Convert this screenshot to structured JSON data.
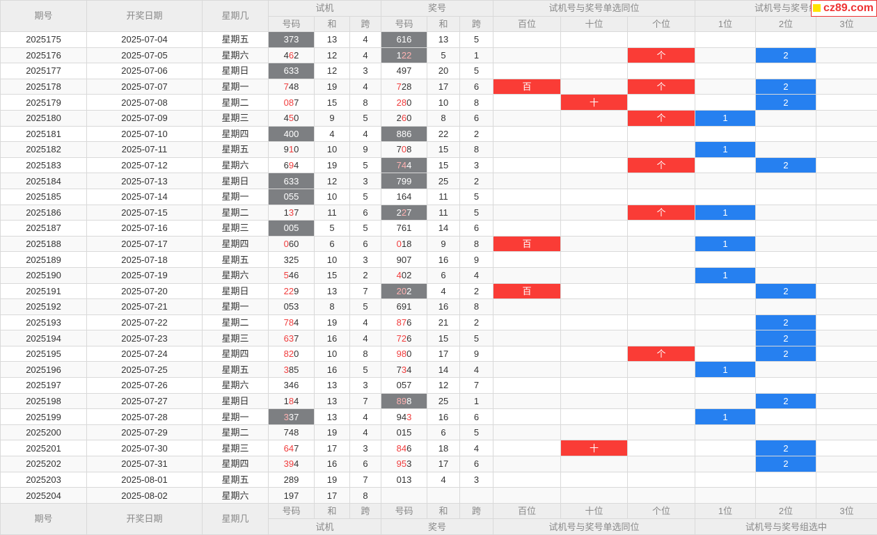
{
  "header": {
    "col_issue": "期号",
    "col_date": "开奖日期",
    "col_weekday": "星期几",
    "group_trial": "试机",
    "group_prize": "奖号",
    "group_single": "试机号与奖号单选同位",
    "group_combo_top": "试机号与奖号组",
    "sub_code": "号码",
    "sub_sum": "和",
    "sub_span": "跨",
    "sub_hundred": "百位",
    "sub_ten": "十位",
    "sub_unit": "个位",
    "sub_c1": "1位",
    "sub_c2": "2位",
    "sub_c3": "3位"
  },
  "footer": {
    "group_combo": "试机号与奖号组选中"
  },
  "watermark": "cz89.com",
  "colors": {
    "gray": "#7d7f82",
    "red": "#fa3c36",
    "blue": "#2680f0",
    "text_red": "#f03c3c"
  },
  "rows": [
    {
      "issue": "2025175",
      "date": "2025-07-04",
      "wd": "星期五",
      "t": "373",
      "th": 0,
      "ts": "13",
      "tk": "4",
      "p": "616",
      "ph": 0,
      "ps": "13",
      "pk": "5",
      "tg": 1,
      "pg": 1,
      "b": "",
      "s": "",
      "g": "",
      "c1": "",
      "c2": "",
      "c3": ""
    },
    {
      "issue": "2025176",
      "date": "2025-07-05",
      "wd": "星期六",
      "t": "462",
      "th": 2,
      "ts": "12",
      "tk": "4",
      "p": "122",
      "ph": 3,
      "ps": "5",
      "pk": "1",
      "tg": 0,
      "pg": 1,
      "b": "",
      "s": "",
      "g": "个",
      "c1": "",
      "c2": "2",
      "c3": ""
    },
    {
      "issue": "2025177",
      "date": "2025-07-06",
      "wd": "星期日",
      "t": "633",
      "th": 0,
      "ts": "12",
      "tk": "3",
      "p": "497",
      "ph": 0,
      "ps": "20",
      "pk": "5",
      "tg": 1,
      "pg": 0,
      "b": "",
      "s": "",
      "g": "",
      "c1": "",
      "c2": "",
      "c3": ""
    },
    {
      "issue": "2025178",
      "date": "2025-07-07",
      "wd": "星期一",
      "t": "748",
      "th": 4,
      "ts": "19",
      "tk": "4",
      "p": "728",
      "ph": 4,
      "ps": "17",
      "pk": "6",
      "tg": 0,
      "pg": 0,
      "b": "百",
      "s": "",
      "g": "个",
      "c1": "",
      "c2": "2",
      "c3": ""
    },
    {
      "issue": "2025179",
      "date": "2025-07-08",
      "wd": "星期二",
      "t": "087",
      "th": 6,
      "ts": "15",
      "tk": "8",
      "p": "280",
      "ph": 6,
      "ps": "10",
      "pk": "8",
      "tg": 0,
      "pg": 0,
      "b": "",
      "s": "十",
      "g": "",
      "c1": "",
      "c2": "2",
      "c3": ""
    },
    {
      "issue": "2025180",
      "date": "2025-07-09",
      "wd": "星期三",
      "t": "450",
      "th": 2,
      "ts": "9",
      "tk": "5",
      "p": "260",
      "ph": 2,
      "ps": "8",
      "pk": "6",
      "tg": 0,
      "pg": 0,
      "b": "",
      "s": "",
      "g": "个",
      "c1": "1",
      "c2": "",
      "c3": ""
    },
    {
      "issue": "2025181",
      "date": "2025-07-10",
      "wd": "星期四",
      "t": "400",
      "th": 0,
      "ts": "4",
      "tk": "4",
      "p": "886",
      "ph": 0,
      "ps": "22",
      "pk": "2",
      "tg": 1,
      "pg": 1,
      "b": "",
      "s": "",
      "g": "",
      "c1": "",
      "c2": "",
      "c3": ""
    },
    {
      "issue": "2025182",
      "date": "2025-07-11",
      "wd": "星期五",
      "t": "910",
      "th": 2,
      "ts": "10",
      "tk": "9",
      "p": "708",
      "ph": 2,
      "ps": "15",
      "pk": "8",
      "tg": 0,
      "pg": 0,
      "b": "",
      "s": "",
      "g": "",
      "c1": "1",
      "c2": "",
      "c3": ""
    },
    {
      "issue": "2025183",
      "date": "2025-07-12",
      "wd": "星期六",
      "t": "694",
      "th": 2,
      "ts": "19",
      "tk": "5",
      "p": "744",
      "ph": 6,
      "ps": "15",
      "pk": "3",
      "tg": 0,
      "pg": 1,
      "b": "",
      "s": "",
      "g": "个",
      "c1": "",
      "c2": "2",
      "c3": ""
    },
    {
      "issue": "2025184",
      "date": "2025-07-13",
      "wd": "星期日",
      "t": "633",
      "th": 0,
      "ts": "12",
      "tk": "3",
      "p": "799",
      "ph": 0,
      "ps": "25",
      "pk": "2",
      "tg": 1,
      "pg": 1,
      "b": "",
      "s": "",
      "g": "",
      "c1": "",
      "c2": "",
      "c3": ""
    },
    {
      "issue": "2025185",
      "date": "2025-07-14",
      "wd": "星期一",
      "t": "055",
      "th": 0,
      "ts": "10",
      "tk": "5",
      "p": "164",
      "ph": 0,
      "ps": "11",
      "pk": "5",
      "tg": 1,
      "pg": 0,
      "b": "",
      "s": "",
      "g": "",
      "c1": "",
      "c2": "",
      "c3": ""
    },
    {
      "issue": "2025186",
      "date": "2025-07-15",
      "wd": "星期二",
      "t": "137",
      "th": 2,
      "ts": "11",
      "tk": "6",
      "p": "227",
      "ph": 2,
      "ps": "11",
      "pk": "5",
      "tg": 0,
      "pg": 1,
      "b": "",
      "s": "",
      "g": "个",
      "c1": "1",
      "c2": "",
      "c3": ""
    },
    {
      "issue": "2025187",
      "date": "2025-07-16",
      "wd": "星期三",
      "t": "005",
      "th": 0,
      "ts": "5",
      "tk": "5",
      "p": "761",
      "ph": 0,
      "ps": "14",
      "pk": "6",
      "tg": 1,
      "pg": 0,
      "b": "",
      "s": "",
      "g": "",
      "c1": "",
      "c2": "",
      "c3": ""
    },
    {
      "issue": "2025188",
      "date": "2025-07-17",
      "wd": "星期四",
      "t": "060",
      "th": 4,
      "ts": "6",
      "tk": "6",
      "p": "018",
      "ph": 4,
      "ps": "9",
      "pk": "8",
      "tg": 0,
      "pg": 0,
      "b": "百",
      "s": "",
      "g": "",
      "c1": "1",
      "c2": "",
      "c3": ""
    },
    {
      "issue": "2025189",
      "date": "2025-07-18",
      "wd": "星期五",
      "t": "325",
      "th": 0,
      "ts": "10",
      "tk": "3",
      "p": "907",
      "ph": 0,
      "ps": "16",
      "pk": "9",
      "tg": 0,
      "pg": 0,
      "b": "",
      "s": "",
      "g": "",
      "c1": "",
      "c2": "",
      "c3": ""
    },
    {
      "issue": "2025190",
      "date": "2025-07-19",
      "wd": "星期六",
      "t": "546",
      "th": 4,
      "ts": "15",
      "tk": "2",
      "p": "402",
      "ph": 4,
      "ps": "6",
      "pk": "4",
      "tg": 0,
      "pg": 0,
      "b": "",
      "s": "",
      "g": "",
      "c1": "1",
      "c2": "",
      "c3": ""
    },
    {
      "issue": "2025191",
      "date": "2025-07-20",
      "wd": "星期日",
      "t": "229",
      "th": 6,
      "ts": "13",
      "tk": "7",
      "p": "202",
      "ph": 6,
      "ps": "4",
      "pk": "2",
      "tg": 0,
      "pg": 1,
      "b": "百",
      "s": "",
      "g": "",
      "c1": "",
      "c2": "2",
      "c3": ""
    },
    {
      "issue": "2025192",
      "date": "2025-07-21",
      "wd": "星期一",
      "t": "053",
      "th": 0,
      "ts": "8",
      "tk": "5",
      "p": "691",
      "ph": 0,
      "ps": "16",
      "pk": "8",
      "tg": 0,
      "pg": 0,
      "b": "",
      "s": "",
      "g": "",
      "c1": "",
      "c2": "",
      "c3": ""
    },
    {
      "issue": "2025193",
      "date": "2025-07-22",
      "wd": "星期二",
      "t": "784",
      "th": 6,
      "ts": "19",
      "tk": "4",
      "p": "876",
      "ph": 6,
      "ps": "21",
      "pk": "2",
      "tg": 0,
      "pg": 0,
      "b": "",
      "s": "",
      "g": "",
      "c1": "",
      "c2": "2",
      "c3": ""
    },
    {
      "issue": "2025194",
      "date": "2025-07-23",
      "wd": "星期三",
      "t": "637",
      "th": 6,
      "ts": "16",
      "tk": "4",
      "p": "726",
      "ph": 6,
      "ps": "15",
      "pk": "5",
      "tg": 0,
      "pg": 0,
      "b": "",
      "s": "",
      "g": "",
      "c1": "",
      "c2": "2",
      "c3": ""
    },
    {
      "issue": "2025195",
      "date": "2025-07-24",
      "wd": "星期四",
      "t": "820",
      "th": 6,
      "ts": "10",
      "tk": "8",
      "p": "980",
      "ph": 6,
      "ps": "17",
      "pk": "9",
      "tg": 0,
      "pg": 0,
      "b": "",
      "s": "",
      "g": "个",
      "c1": "",
      "c2": "2",
      "c3": ""
    },
    {
      "issue": "2025196",
      "date": "2025-07-25",
      "wd": "星期五",
      "t": "385",
      "th": 4,
      "ts": "16",
      "tk": "5",
      "p": "734",
      "ph": 2,
      "ps": "14",
      "pk": "4",
      "tg": 0,
      "pg": 0,
      "b": "",
      "s": "",
      "g": "",
      "c1": "1",
      "c2": "",
      "c3": ""
    },
    {
      "issue": "2025197",
      "date": "2025-07-26",
      "wd": "星期六",
      "t": "346",
      "th": 0,
      "ts": "13",
      "tk": "3",
      "p": "057",
      "ph": 0,
      "ps": "12",
      "pk": "7",
      "tg": 0,
      "pg": 0,
      "b": "",
      "s": "",
      "g": "",
      "c1": "",
      "c2": "",
      "c3": ""
    },
    {
      "issue": "2025198",
      "date": "2025-07-27",
      "wd": "星期日",
      "t": "184",
      "th": 2,
      "ts": "13",
      "tk": "7",
      "p": "898",
      "ph": 6,
      "ps": "25",
      "pk": "1",
      "tg": 0,
      "pg": 1,
      "b": "",
      "s": "",
      "g": "",
      "c1": "",
      "c2": "2",
      "c3": ""
    },
    {
      "issue": "2025199",
      "date": "2025-07-28",
      "wd": "星期一",
      "t": "337",
      "th": 4,
      "ts": "13",
      "tk": "4",
      "p": "943",
      "ph": 1,
      "ps": "16",
      "pk": "6",
      "tg": 1,
      "pg": 0,
      "b": "",
      "s": "",
      "g": "",
      "c1": "1",
      "c2": "",
      "c3": ""
    },
    {
      "issue": "2025200",
      "date": "2025-07-29",
      "wd": "星期二",
      "t": "748",
      "th": 0,
      "ts": "19",
      "tk": "4",
      "p": "015",
      "ph": 0,
      "ps": "6",
      "pk": "5",
      "tg": 0,
      "pg": 0,
      "b": "",
      "s": "",
      "g": "",
      "c1": "",
      "c2": "",
      "c3": ""
    },
    {
      "issue": "2025201",
      "date": "2025-07-30",
      "wd": "星期三",
      "t": "647",
      "th": 6,
      "ts": "17",
      "tk": "3",
      "p": "846",
      "ph": 6,
      "ps": "18",
      "pk": "4",
      "tg": 0,
      "pg": 0,
      "b": "",
      "s": "十",
      "g": "",
      "c1": "",
      "c2": "2",
      "c3": ""
    },
    {
      "issue": "2025202",
      "date": "2025-07-31",
      "wd": "星期四",
      "t": "394",
      "th": 6,
      "ts": "16",
      "tk": "6",
      "p": "953",
      "ph": 6,
      "ps": "17",
      "pk": "6",
      "tg": 0,
      "pg": 0,
      "b": "",
      "s": "",
      "g": "",
      "c1": "",
      "c2": "2",
      "c3": ""
    },
    {
      "issue": "2025203",
      "date": "2025-08-01",
      "wd": "星期五",
      "t": "289",
      "th": 0,
      "ts": "19",
      "tk": "7",
      "p": "013",
      "ph": 0,
      "ps": "4",
      "pk": "3",
      "tg": 0,
      "pg": 0,
      "b": "",
      "s": "",
      "g": "",
      "c1": "",
      "c2": "",
      "c3": ""
    },
    {
      "issue": "2025204",
      "date": "2025-08-02",
      "wd": "星期六",
      "t": "197",
      "th": 0,
      "ts": "17",
      "tk": "8",
      "p": "",
      "ph": 0,
      "ps": "",
      "pk": "",
      "tg": 0,
      "pg": 0,
      "b": "",
      "s": "",
      "g": "",
      "c1": "",
      "c2": "",
      "c3": ""
    }
  ]
}
